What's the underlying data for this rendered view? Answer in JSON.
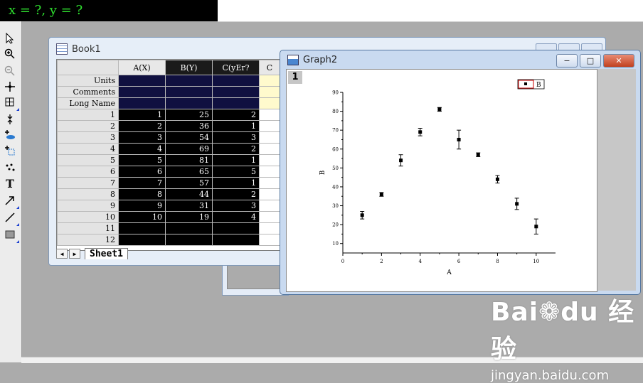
{
  "readout": {
    "text": "x = ?, y = ?"
  },
  "toolbar": {
    "tools": [
      "pointer-icon",
      "zoom-in-icon",
      "zoom-out-icon",
      "screen-reader-icon",
      "data-selector-icon",
      "mask-icon",
      "data-reader-icon",
      "region-mask-icon",
      "scatter-icon",
      "text-icon",
      "arrow-icon",
      "line-icon",
      "rectangle-icon"
    ]
  },
  "book": {
    "title": "Book1",
    "columns": [
      "A(X)",
      "B(Y)",
      "C(yEr?",
      "C"
    ],
    "meta_rows": [
      "Units",
      "Comments",
      "Long Name"
    ],
    "rows": [
      {
        "n": "1",
        "a": "1",
        "b": "25",
        "c": "2"
      },
      {
        "n": "2",
        "a": "2",
        "b": "36",
        "c": "1"
      },
      {
        "n": "3",
        "a": "3",
        "b": "54",
        "c": "3"
      },
      {
        "n": "4",
        "a": "4",
        "b": "69",
        "c": "2"
      },
      {
        "n": "5",
        "a": "5",
        "b": "81",
        "c": "1"
      },
      {
        "n": "6",
        "a": "6",
        "b": "65",
        "c": "5"
      },
      {
        "n": "7",
        "a": "7",
        "b": "57",
        "c": "1"
      },
      {
        "n": "8",
        "a": "8",
        "b": "44",
        "c": "2"
      },
      {
        "n": "9",
        "a": "9",
        "b": "31",
        "c": "3"
      },
      {
        "n": "10",
        "a": "10",
        "b": "19",
        "c": "4"
      },
      {
        "n": "11",
        "a": "",
        "b": "",
        "c": ""
      },
      {
        "n": "12",
        "a": "",
        "b": "",
        "c": ""
      }
    ],
    "sheet_tab": "Sheet1"
  },
  "graph": {
    "title": "Graph2",
    "layer": "1",
    "minimize_label": "−",
    "maximize_label": "□",
    "close_label": "✕"
  },
  "chart_data": {
    "type": "scatter",
    "title": "",
    "xlabel": "A",
    "ylabel": "B",
    "xlim": [
      0,
      11
    ],
    "ylim": [
      5,
      90
    ],
    "xticks": [
      "0",
      "2",
      "4",
      "6",
      "8",
      "10"
    ],
    "yticks": [
      "10",
      "20",
      "30",
      "40",
      "50",
      "60",
      "70",
      "80",
      "90"
    ],
    "legend": "top-right",
    "series": [
      {
        "name": "B",
        "x": [
          1,
          2,
          3,
          4,
          5,
          6,
          7,
          8,
          9,
          10
        ],
        "y": [
          25,
          36,
          54,
          69,
          81,
          65,
          57,
          44,
          31,
          19
        ],
        "yerr": [
          2,
          1,
          3,
          2,
          1,
          5,
          1,
          2,
          3,
          4
        ],
        "color": "#000000"
      }
    ],
    "legend_border_color": "#cc0000"
  },
  "watermark": {
    "logo": "Bai❁du 经验",
    "url": "jingyan.baidu.com"
  }
}
